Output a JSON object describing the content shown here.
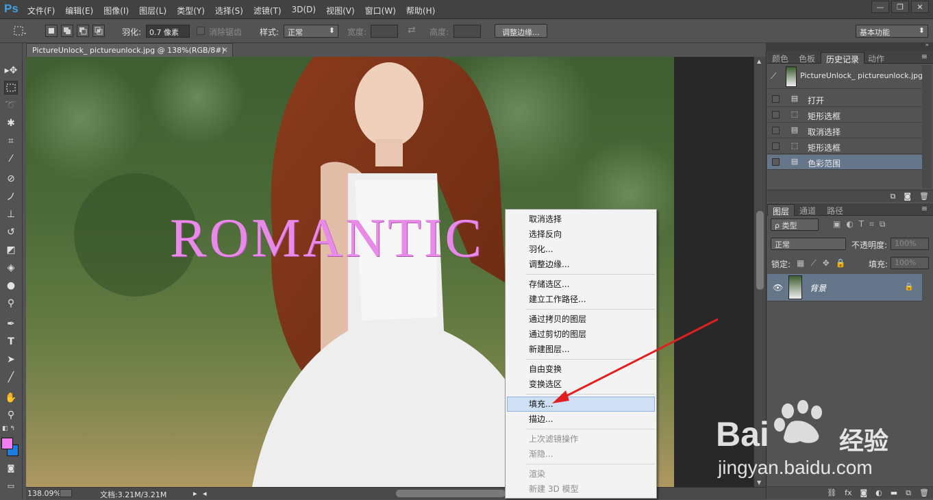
{
  "app": {
    "logo": "Ps"
  },
  "menu": [
    "文件(F)",
    "编辑(E)",
    "图像(I)",
    "图层(L)",
    "类型(Y)",
    "选择(S)",
    "滤镜(T)",
    "3D(D)",
    "视图(V)",
    "窗口(W)",
    "帮助(H)"
  ],
  "window_controls": {
    "minimize": "—",
    "restore": "❐",
    "close": "✕"
  },
  "options_bar": {
    "feather_label": "羽化:",
    "feather_value": "0.7 像素",
    "antialias_label": "消除锯齿",
    "style_label": "样式:",
    "style_value": "正常",
    "width_label": "宽度:",
    "height_label": "高度:",
    "refine_edge_button": "调整边缘...",
    "workspace": "基本功能"
  },
  "document": {
    "tab_title": "PictureUnlock_ pictureunlock.jpg @ 138%(RGB/8#)",
    "tab_close": "×",
    "canvas_text": "ROMANTIC"
  },
  "status_bar": {
    "zoom": "138.09%",
    "doc_size": "文档:3.21M/3.21M"
  },
  "context_menu": {
    "items": [
      {
        "label": "取消选择",
        "enabled": true
      },
      {
        "label": "选择反向",
        "enabled": true
      },
      {
        "label": "羽化...",
        "enabled": true
      },
      {
        "label": "调整边缘...",
        "enabled": true
      },
      {
        "label": "存储选区...",
        "enabled": true
      },
      {
        "label": "建立工作路径...",
        "enabled": true
      },
      {
        "label": "通过拷贝的图层",
        "enabled": true
      },
      {
        "label": "通过剪切的图层",
        "enabled": true
      },
      {
        "label": "新建图层...",
        "enabled": true
      },
      {
        "label": "自由变换",
        "enabled": true
      },
      {
        "label": "变换选区",
        "enabled": true
      },
      {
        "label": "填充...",
        "enabled": true,
        "highlighted": true
      },
      {
        "label": "描边...",
        "enabled": true
      },
      {
        "label": "上次滤镜操作",
        "enabled": false
      },
      {
        "label": "渐隐...",
        "enabled": false
      },
      {
        "label": "渲染",
        "enabled": false
      },
      {
        "label": "新建 3D 模型",
        "enabled": false
      }
    ]
  },
  "history_panel": {
    "tabs": [
      "颜色",
      "色板",
      "历史记录",
      "动作"
    ],
    "active_tab": "历史记录",
    "snapshot": "PictureUnlock_ pictureunlock.jpg",
    "steps": [
      {
        "label": "打开",
        "icon": "document-icon"
      },
      {
        "label": "矩形选框",
        "icon": "marquee-icon"
      },
      {
        "label": "取消选择",
        "icon": "document-icon"
      },
      {
        "label": "矩形选框",
        "icon": "marquee-icon"
      },
      {
        "label": "色彩范围",
        "icon": "document-icon",
        "selected": true
      }
    ]
  },
  "layers_panel": {
    "tabs": [
      "图层",
      "通道",
      "路径"
    ],
    "active_tab": "图层",
    "filter_kind": "ρ 类型",
    "blend_mode": "正常",
    "opacity_label": "不透明度:",
    "opacity_value": "100%",
    "lock_label": "锁定:",
    "fill_label": "填充:",
    "fill_value": "100%",
    "layers": [
      {
        "name": "背景",
        "locked": true,
        "visible": true
      }
    ]
  },
  "colors": {
    "foreground": "#f07ef0",
    "background": "#1a7fe0",
    "accent_arrow": "#e02020",
    "selection_blue": "#65758a"
  },
  "watermark": {
    "brand": "Bai",
    "brand_cn": "经验",
    "url": "jingyan.baidu.com"
  }
}
